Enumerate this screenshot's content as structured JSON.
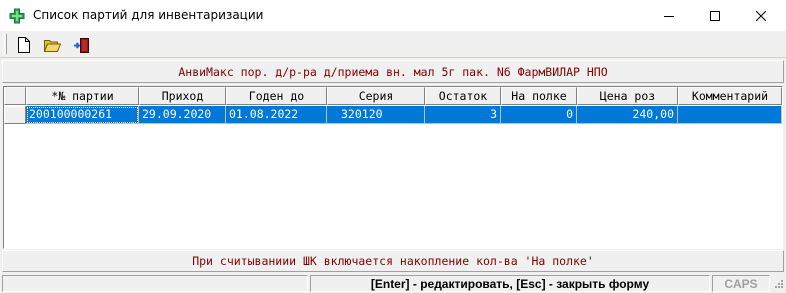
{
  "window": {
    "title": "Список партий для инвентаризации"
  },
  "toolbar": {
    "buttons": [
      {
        "icon": "new-document-icon"
      },
      {
        "icon": "open-folder-icon"
      },
      {
        "icon": "exit-door-icon"
      }
    ]
  },
  "product": {
    "name": "АнвиМакс пор. д/р-ра д/приема вн. мал 5г пак. N6 ФармВИЛАР НПО"
  },
  "grid": {
    "columns": [
      "*№ партии",
      "Приход",
      "Годен до",
      "Серия",
      "Остаток",
      "На полке",
      "Цена роз",
      "Комментарий"
    ],
    "rows": [
      {
        "batch": "200100000261",
        "arrival": "29.09.2020",
        "expiry": "01.08.2022",
        "series": "320120",
        "remaining": "3",
        "on_shelf": "0",
        "price": "240,00",
        "comment": ""
      }
    ]
  },
  "hint": {
    "text": "При считываниии ШК включается накопление кол-ва 'На полке'"
  },
  "status": {
    "panel1": "",
    "shortcuts": "[Enter] - редактировать, [Esc] - закрыть форму",
    "caps": "CAPS"
  },
  "colors": {
    "accent_text": "#800000",
    "selection": "#0078d7",
    "app_icon": "#2fa84f"
  }
}
